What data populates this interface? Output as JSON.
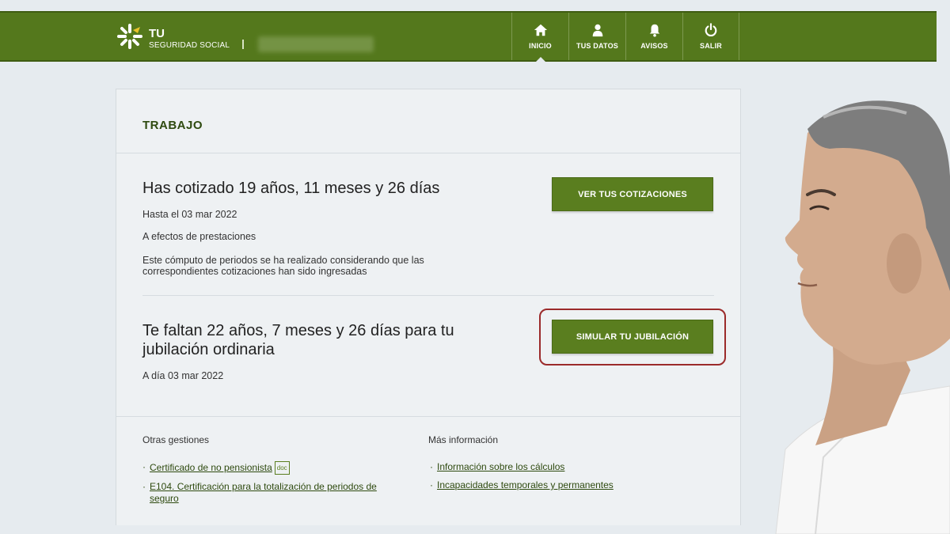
{
  "header": {
    "brand_line1": "TU",
    "brand_line2": "SEGURIDAD SOCIAL",
    "nav": [
      {
        "label": "INICIO",
        "icon": "home-icon"
      },
      {
        "label": "TUS DATOS",
        "icon": "user-icon"
      },
      {
        "label": "AVISOS",
        "icon": "bell-icon"
      },
      {
        "label": "SALIR",
        "icon": "power-icon"
      }
    ]
  },
  "card": {
    "title": "TRABAJO",
    "cotizado": {
      "heading": "Has cotizado 19 años, 11 meses y 26 días",
      "date": "Hasta el 03 mar 2022",
      "note1": "A efectos de prestaciones",
      "note2_line1": "Este cómputo de periodos se ha realizado considerando que las",
      "note2_line2": "correspondientes cotizaciones han sido ingresadas",
      "button": "VER TUS COTIZACIONES"
    },
    "faltan": {
      "heading_line1": "Te faltan 22 años, 7 meses y 26 días para tu",
      "heading_line2": "jubilación ordinaria",
      "date": "A día 03 mar 2022",
      "button": "SIMULAR TU JUBILACIÓN"
    },
    "otras": {
      "title": "Otras gestiones",
      "links": [
        {
          "text": "Certificado de no pensionista",
          "badge": "doc"
        },
        {
          "text_line1": "E104. Certificación para la totalización de periodos de",
          "text_line2": "seguro"
        }
      ]
    },
    "mas": {
      "title": "Más información",
      "links": [
        {
          "text": "Información sobre los cálculos"
        },
        {
          "text": "Incapacidades temporales y permanentes"
        }
      ]
    }
  },
  "colors": {
    "header_green": "#54781c",
    "button_green": "#5a7e1f",
    "highlight_red": "#9b2a2a"
  }
}
